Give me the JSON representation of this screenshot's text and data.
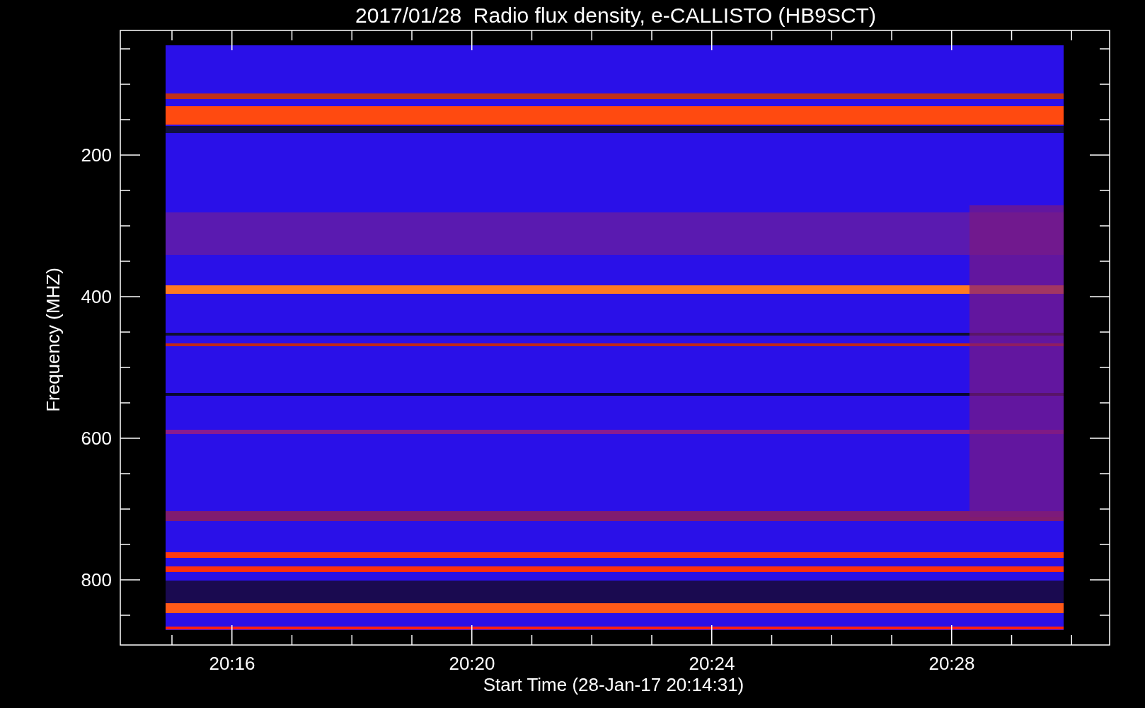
{
  "title": "2017/01/28  Radio flux density, e-CALLISTO (HB9SCT)",
  "y_axis": {
    "label": "Frequency (MHZ)",
    "ticks": [
      "200",
      "400",
      "600",
      "800"
    ]
  },
  "x_axis": {
    "label": "Start Time (28-Jan-17 20:14:31)",
    "ticks": [
      "20:16",
      "20:20",
      "20:24",
      "20:28"
    ]
  }
}
